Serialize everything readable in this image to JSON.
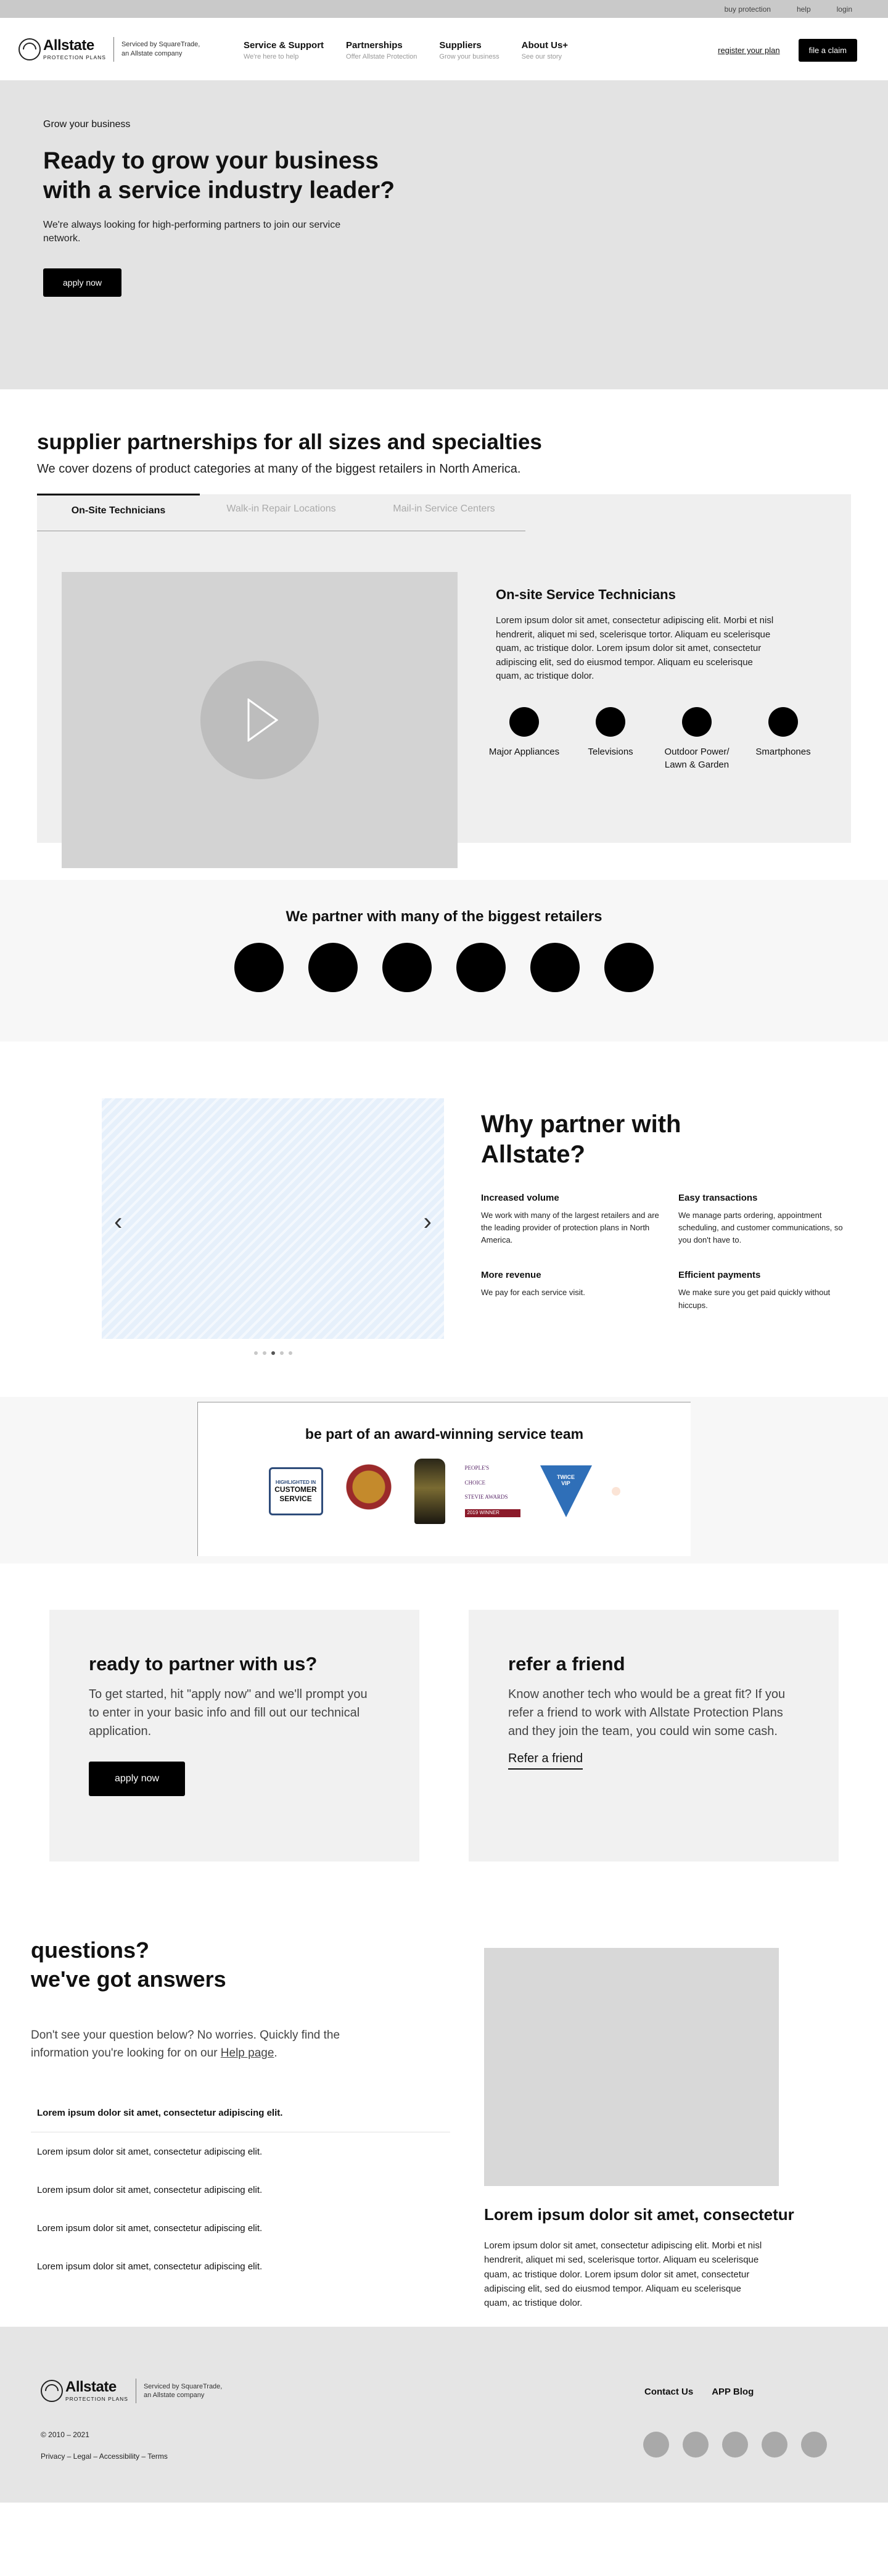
{
  "utility": {
    "links": [
      "buy protection",
      "help",
      "login"
    ]
  },
  "brand": {
    "logo_name": "Allstate",
    "logo_sub": "PROTECTION PLANS",
    "serviced_by": "Serviced by SquareTrade, an Allstate company"
  },
  "nav": [
    {
      "title": "Service & Support",
      "sub": "We're here to help"
    },
    {
      "title": "Partnerships",
      "sub": "Offer Allstate Protection"
    },
    {
      "title": "Suppliers",
      "sub": "Grow your business"
    },
    {
      "title": "About Us+",
      "sub": "See our story"
    }
  ],
  "header": {
    "register_label": "register your plan",
    "claim_label": "file a claim"
  },
  "hero": {
    "eyebrow": "Grow your business",
    "title": "Ready to grow your business with a service industry leader?",
    "text": "We're always looking for high-performing partners to join our service network.",
    "button": "apply now"
  },
  "suppliers": {
    "title_prefix": "supplier partnerships for ",
    "title_bold": "all sizes and specialties",
    "subtitle": "We cover dozens of product categories at many of the biggest retailers in North America.",
    "tabs": [
      "On-Site Technicians",
      "Walk-in Repair Locations",
      "Mail-in Service Centers"
    ],
    "panel_title": "On-site Service Technicians",
    "panel_text": "Lorem ipsum dolor sit amet, consectetur adipiscing elit. Morbi et nisl hendrerit, aliquet mi sed, scelerisque tortor. Aliquam eu scelerisque quam, ac tristique dolor. Lorem ipsum dolor sit amet, consectetur adipiscing elit, sed do eiusmod tempor.  Aliquam eu scelerisque quam, ac tristique dolor.",
    "categories": [
      "Major Appliances",
      "Televisions",
      "Outdoor Power/ Lawn & Garden",
      "Smartphones"
    ]
  },
  "retailers": {
    "title": "We partner with many of the biggest retailers",
    "logo_count": 6
  },
  "why": {
    "title": "Why partner with Allstate?",
    "features": [
      {
        "title": "Increased volume",
        "text": "We work with many of the largest retailers and are the leading provider of protection plans in North America."
      },
      {
        "title": "Easy transactions",
        "text": "We manage parts ordering, appointment scheduling, and customer communications, so you don't have to."
      },
      {
        "title": "More revenue",
        "text": "We pay for each service visit."
      },
      {
        "title": "Efficient payments",
        "text": "We make sure you get paid quickly without hiccups."
      }
    ],
    "carousel_active_slide": 3,
    "carousel_slide_count": 5
  },
  "awards": {
    "title_prefix": "be part of an ",
    "title_bold": "award-winning service team",
    "badge1_top": "HIGHLIGHTED IN",
    "badge1_main": "CUSTOMER SERVICE",
    "badge4_line1": "PEOPLE'S",
    "badge4_line2": "CHOICE",
    "badge4_line3": "STEVIE AWARDS",
    "badge4_bar": "2019 WINNER",
    "badge5_text": "TWICE VIP"
  },
  "cta": {
    "left_title": "ready to partner with us?",
    "left_text": "To get started, hit \"apply now\" and we'll prompt you to enter in your basic info and fill out our technical application.",
    "left_button": "apply now",
    "right_title": "refer a friend",
    "right_text": "Know another tech who would be a great fit? If you refer a friend to work with Allstate Protection Plans and they join the team, you could win some cash.",
    "right_link": "Refer a friend"
  },
  "faq": {
    "title_line1": "questions?",
    "title_line2": "we've got answers",
    "desc_prefix": "Don't see your question below? No worries. Quickly find the information you're looking for on our ",
    "desc_link": "Help page",
    "desc_suffix": ".",
    "items": [
      "Lorem ipsum dolor sit amet, consectetur adipiscing elit.",
      "Lorem ipsum dolor sit amet, consectetur adipiscing elit.",
      "Lorem ipsum dolor sit amet, consectetur adipiscing elit.",
      "Lorem ipsum dolor sit amet, consectetur adipiscing elit.",
      "Lorem ipsum dolor sit amet, consectetur adipiscing elit."
    ],
    "card_title": "Lorem ipsum dolor sit amet, consectetur",
    "card_text": "Lorem ipsum dolor sit amet, consectetur adipiscing elit. Morbi et nisl hendrerit, aliquet mi sed, scelerisque tortor. Aliquam eu scelerisque quam, ac tristique dolor. Lorem ipsum dolor sit amet, consectetur adipiscing elit, sed do eiusmod tempor.  Aliquam eu scelerisque quam, ac tristique dolor."
  },
  "footer": {
    "links": [
      "Contact Us",
      "APP Blog"
    ],
    "copyright": "© 2010 – 2021",
    "legal": "Privacy – Legal – Accessibility – Terms",
    "social_count": 5
  }
}
